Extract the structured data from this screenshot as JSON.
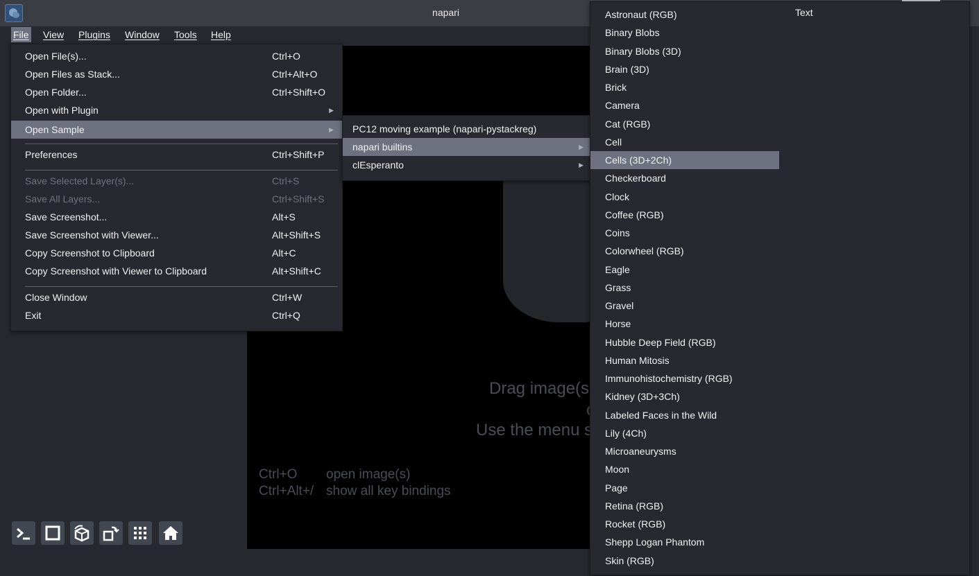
{
  "window": {
    "title": "napari"
  },
  "menubar": {
    "items": [
      "File",
      "View",
      "Plugins",
      "Window",
      "Tools",
      "Help"
    ],
    "active": "File"
  },
  "file_menu": {
    "items": [
      {
        "label": "Open File(s)...",
        "shortcut": "Ctrl+O"
      },
      {
        "label": "Open Files as Stack...",
        "shortcut": "Ctrl+Alt+O"
      },
      {
        "label": "Open Folder...",
        "shortcut": "Ctrl+Shift+O"
      },
      {
        "label": "Open with Plugin",
        "shortcut": ""
      },
      {
        "label": "Open Sample",
        "shortcut": ""
      },
      {
        "label": "Preferences",
        "shortcut": "Ctrl+Shift+P"
      },
      {
        "label": "Save Selected Layer(s)...",
        "shortcut": "Ctrl+S"
      },
      {
        "label": "Save All Layers...",
        "shortcut": "Ctrl+Shift+S"
      },
      {
        "label": "Save Screenshot...",
        "shortcut": "Alt+S"
      },
      {
        "label": "Save Screenshot with Viewer...",
        "shortcut": "Alt+Shift+S"
      },
      {
        "label": "Copy Screenshot to Clipboard",
        "shortcut": "Alt+C"
      },
      {
        "label": "Copy Screenshot with Viewer to Clipboard",
        "shortcut": "Alt+Shift+C"
      },
      {
        "label": "Close Window",
        "shortcut": "Ctrl+W"
      },
      {
        "label": "Exit",
        "shortcut": "Ctrl+Q"
      }
    ]
  },
  "sample_menu": {
    "items": [
      "PC12 moving example (napari-pystackreg)",
      "napari builtins",
      "clEsperanto"
    ]
  },
  "builtins_menu": {
    "column_header": "Text",
    "items": [
      "Astronaut (RGB)",
      "Binary Blobs",
      "Binary Blobs (3D)",
      "Brain (3D)",
      "Brick",
      "Camera",
      "Cat (RGB)",
      "Cell",
      "Cells (3D+2Ch)",
      "Checkerboard",
      "Clock",
      "Coffee (RGB)",
      "Coins",
      "Colorwheel (RGB)",
      "Eagle",
      "Grass",
      "Gravel",
      "Horse",
      "Hubble Deep Field (RGB)",
      "Human Mitosis",
      "Immunohistochemistry (RGB)",
      "Kidney (3D+3Ch)",
      "Labeled Faces in the Wild",
      "Lily (4Ch)",
      "Microaneurysms",
      "Moon",
      "Page",
      "Retina (RGB)",
      "Rocket (RGB)",
      "Shepp Logan Phantom",
      "Skin (RGB)"
    ],
    "highlighted": "Cells (3D+2Ch)"
  },
  "welcome": {
    "line1": "Drag image(s",
    "line2": "o",
    "line3": "Use the menu s",
    "shortcuts": [
      {
        "keys": "Ctrl+O",
        "desc": "open image(s)"
      },
      {
        "keys": "Ctrl+Alt+/",
        "desc": "show all key bindings"
      }
    ]
  },
  "bottom_buttons": [
    "console-icon",
    "ndisplay-square-icon",
    "roll-dims-icon",
    "transpose-icon",
    "grid-icon",
    "home-icon"
  ]
}
